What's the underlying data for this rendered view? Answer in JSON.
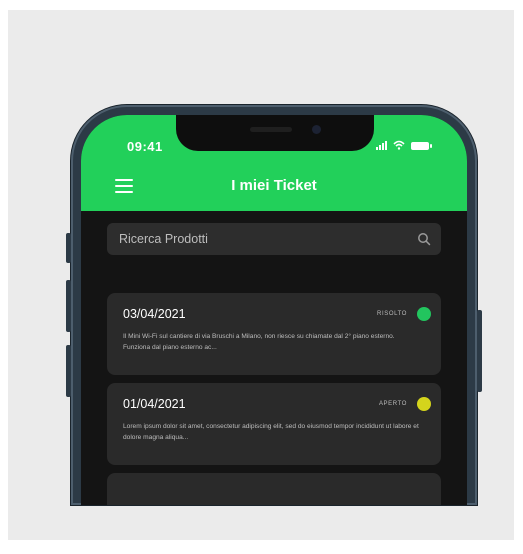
{
  "status_bar": {
    "time": "09:41"
  },
  "header": {
    "title": "I miei Ticket"
  },
  "search": {
    "placeholder": "Ricerca Prodotti"
  },
  "colors": {
    "accent": "#22d05a",
    "resolved": "#22c55e",
    "open": "#d4d41c"
  },
  "tickets": [
    {
      "date": "03/04/2021",
      "status": "RISOLTO",
      "description": "Il Mini Wi-Fi sul cantiere di via Bruschi a Milano, non riesce su chiamate dal 2° piano esterno. Funziona dal piano esterno ac..."
    },
    {
      "date": "01/04/2021",
      "status": "APERTO",
      "description": "Lorem ipsum dolor sit amet, consectetur adipiscing elit, sed do eiusmod tempor incididunt ut labore et dolore magna aliqua..."
    }
  ]
}
